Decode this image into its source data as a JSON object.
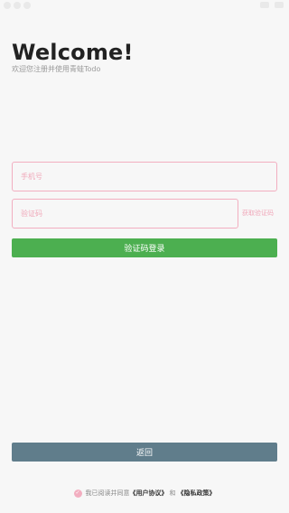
{
  "header": {
    "title": "Welcome!",
    "subtitle": "欢迎您注册并使用青蛙Todo"
  },
  "form": {
    "phone_placeholder": "手机号",
    "code_placeholder": "验证码",
    "get_code_label": "获取验证码",
    "login_label": "验证码登录"
  },
  "footer": {
    "back_label": "返回",
    "agreement_prefix": "我已阅读并同意",
    "user_agreement": "《用户协议》",
    "and_text": "和",
    "privacy_policy": "《隐私政策》",
    "agreed": true
  },
  "colors": {
    "accent_pink": "#f2aec0",
    "login_green": "#4caf50",
    "back_gray": "#607d8b"
  }
}
